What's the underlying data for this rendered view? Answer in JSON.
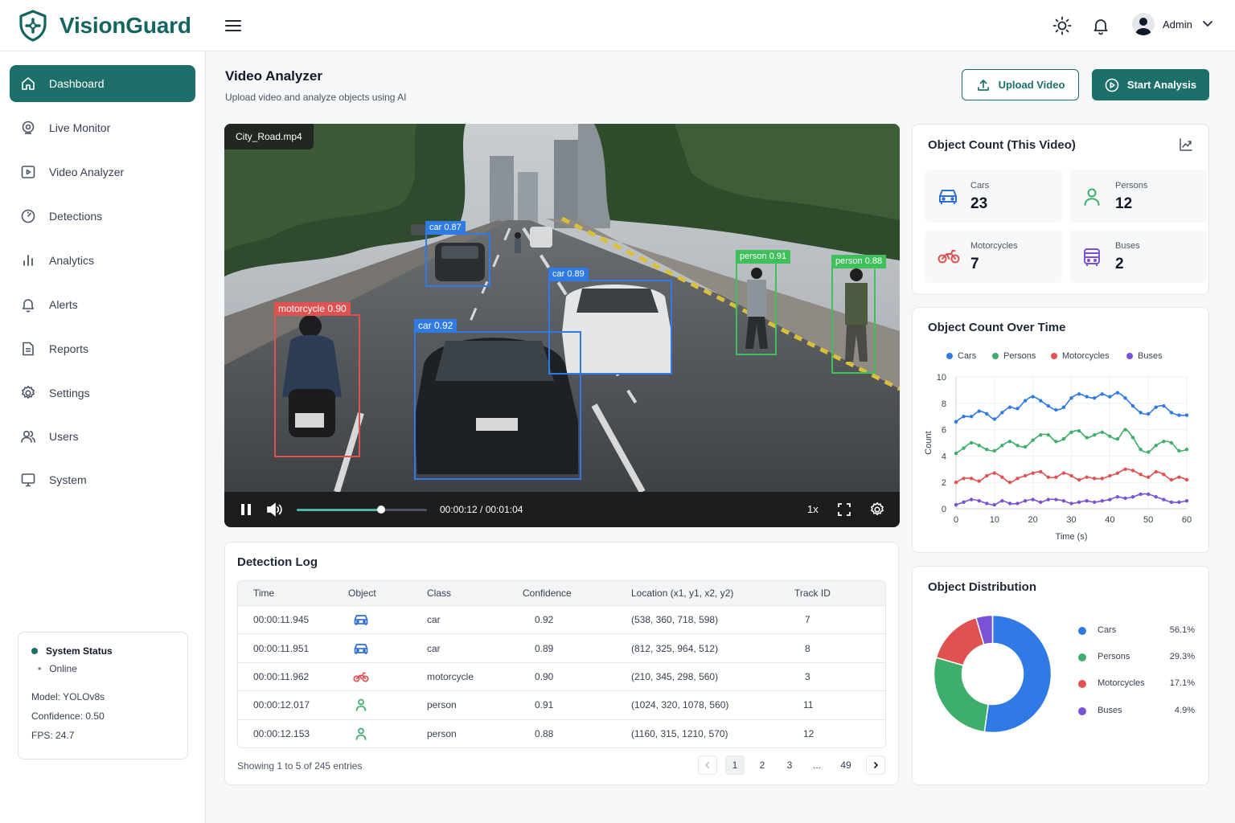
{
  "app": {
    "name": "VisionGuard",
    "brand_color": "#1c7069"
  },
  "header": {
    "user": "Admin",
    "icons": [
      "menu-icon",
      "sun-icon",
      "bell-icon",
      "user-avatar-icon",
      "chevron-down-icon"
    ]
  },
  "sidebar": {
    "items": [
      {
        "label": "Dashboard",
        "icon": "home-icon",
        "active": true
      },
      {
        "label": "Live Monitor",
        "icon": "webcam-icon"
      },
      {
        "label": "Video Analyzer",
        "icon": "video-icon"
      },
      {
        "label": "Detections",
        "icon": "gauge-icon"
      },
      {
        "label": "Analytics",
        "icon": "bar-chart-icon"
      },
      {
        "label": "Alerts",
        "icon": "bell-icon"
      },
      {
        "label": "Reports",
        "icon": "report-icon"
      },
      {
        "label": "Settings",
        "icon": "gear-icon"
      },
      {
        "label": "Users",
        "icon": "users-icon"
      },
      {
        "label": "System",
        "icon": "monitor-icon"
      }
    ],
    "status": {
      "title": "System Status",
      "state": "Online",
      "model_label": "Model:",
      "model": "YOLOv8s",
      "confidence_label": "Confidence:",
      "confidence": "0.50",
      "fps_label": "FPS:",
      "fps": "24.7"
    }
  },
  "main": {
    "title": "Video Analyzer",
    "subtitle": "Upload video and analyze objects using AI",
    "upload_label": "Upload Video",
    "start_label": "Start Analysis"
  },
  "video": {
    "filename": "City_Road.mp4",
    "time": "00:00:12 / 00:01:04",
    "progress": 0.65,
    "speed": "1x",
    "detections": [
      {
        "label": "car 0.87",
        "color": "#2f7ae5"
      },
      {
        "label": "car 0.89",
        "color": "#2f7ae5"
      },
      {
        "label": "car 0.92",
        "color": "#2f7ae5"
      },
      {
        "label": "motorcycle 0.90",
        "color": "#e05252"
      },
      {
        "label": "person 0.91",
        "color": "#3fc05a"
      },
      {
        "label": "person 0.88",
        "color": "#3fc05a"
      }
    ]
  },
  "log": {
    "title": "Detection Log",
    "columns": [
      "Time",
      "Object",
      "Class",
      "Confidence",
      "Location (x1, y1, x2, y2)",
      "Track ID"
    ],
    "rows": [
      {
        "time": "00:00:11.945",
        "icon": "car-icon",
        "cls": "car",
        "conf": "0.92",
        "loc": "(538, 360, 718, 598)",
        "track": "7"
      },
      {
        "time": "00:00:11.951",
        "icon": "car-icon",
        "cls": "car",
        "conf": "0.89",
        "loc": "(812, 325, 964, 512)",
        "track": "8"
      },
      {
        "time": "00:00:11.962",
        "icon": "motorcycle-icon",
        "cls": "motorcycle",
        "conf": "0.90",
        "loc": "(210, 345, 298, 560)",
        "track": "3"
      },
      {
        "time": "00:00:12.017",
        "icon": "person-icon",
        "cls": "person",
        "conf": "0.91",
        "loc": "(1024, 320, 1078, 560)",
        "track": "11"
      },
      {
        "time": "00:00:12.153",
        "icon": "person-icon",
        "cls": "person",
        "conf": "0.88",
        "loc": "(1160, 315, 1210, 570)",
        "track": "12"
      }
    ],
    "footer": "Showing 1 to 5 of 245 entries",
    "pages": [
      "1",
      "2",
      "3",
      "...",
      "49"
    ]
  },
  "counts": {
    "title": "Object Count (This Video)",
    "items": [
      {
        "label": "Cars",
        "value": "23",
        "color": "#2f6fd6",
        "icon": "car-icon"
      },
      {
        "label": "Persons",
        "value": "12",
        "color": "#3dae6b",
        "icon": "person-icon"
      },
      {
        "label": "Motorcycles",
        "value": "7",
        "color": "#e05252",
        "icon": "motorcycle-icon"
      },
      {
        "label": "Buses",
        "value": "2",
        "color": "#7b52d6",
        "icon": "bus-icon"
      }
    ]
  },
  "chart_data": [
    {
      "type": "line",
      "title": "Object Count Over Time",
      "xlabel": "Time (s)",
      "ylabel": "Count",
      "xlim": [
        0,
        60
      ],
      "ylim": [
        0,
        10
      ],
      "xticks": [
        0,
        10,
        20,
        30,
        40,
        50,
        60
      ],
      "yticks": [
        0,
        2,
        4,
        6,
        8,
        10
      ],
      "legend": "top",
      "x": [
        0,
        2,
        4,
        6,
        8,
        10,
        12,
        14,
        16,
        18,
        20,
        22,
        24,
        26,
        28,
        30,
        32,
        34,
        36,
        38,
        40,
        42,
        44,
        46,
        48,
        50,
        52,
        54,
        56,
        58,
        60
      ],
      "series": [
        {
          "name": "Cars",
          "color": "#2f7ae5",
          "values": [
            6.6,
            7.0,
            7.0,
            7.4,
            7.2,
            6.8,
            7.3,
            7.7,
            7.6,
            8.2,
            8.5,
            8.2,
            7.8,
            7.5,
            7.7,
            8.4,
            8.7,
            8.5,
            8.4,
            8.7,
            8.5,
            8.8,
            8.4,
            7.8,
            7.3,
            7.2,
            7.7,
            7.8,
            7.3,
            7.1,
            7.1
          ]
        },
        {
          "name": "Persons",
          "color": "#3dae6b",
          "values": [
            4.2,
            4.6,
            5.0,
            4.8,
            4.5,
            4.4,
            4.8,
            5.1,
            4.8,
            4.7,
            5.2,
            5.6,
            5.6,
            5.1,
            5.3,
            5.8,
            5.9,
            5.4,
            5.6,
            5.8,
            5.5,
            5.3,
            6.0,
            5.4,
            4.5,
            4.3,
            4.8,
            5.1,
            5.0,
            4.4,
            4.5
          ]
        },
        {
          "name": "Motorcycles",
          "color": "#e05252",
          "values": [
            2.0,
            2.3,
            2.3,
            2.1,
            2.5,
            2.7,
            2.4,
            2.0,
            2.3,
            2.5,
            2.7,
            2.8,
            2.4,
            2.4,
            2.7,
            2.5,
            2.2,
            2.4,
            2.3,
            2.3,
            2.5,
            2.7,
            3.0,
            2.9,
            2.6,
            2.4,
            2.8,
            2.6,
            2.2,
            2.4,
            2.2
          ]
        },
        {
          "name": "Buses",
          "color": "#7b52d6",
          "values": [
            0.3,
            0.5,
            0.7,
            0.6,
            0.4,
            0.3,
            0.6,
            0.4,
            0.4,
            0.6,
            0.7,
            0.5,
            0.7,
            0.7,
            0.6,
            0.4,
            0.5,
            0.6,
            0.5,
            0.6,
            0.7,
            0.9,
            0.8,
            0.9,
            1.1,
            1.1,
            0.9,
            0.7,
            0.5,
            0.5,
            0.6
          ]
        }
      ]
    },
    {
      "type": "pie",
      "title": "Object Distribution",
      "donut": true,
      "legend": "right",
      "categories": [
        "Cars",
        "Persons",
        "Motorcycles",
        "Buses"
      ],
      "values": [
        56.1,
        29.3,
        17.1,
        4.9
      ],
      "labels": [
        "56.1%",
        "29.3%",
        "17.1%",
        "4.9%"
      ],
      "colors": [
        "#2f7ae5",
        "#3dae6b",
        "#e05252",
        "#7b52d6"
      ]
    }
  ]
}
